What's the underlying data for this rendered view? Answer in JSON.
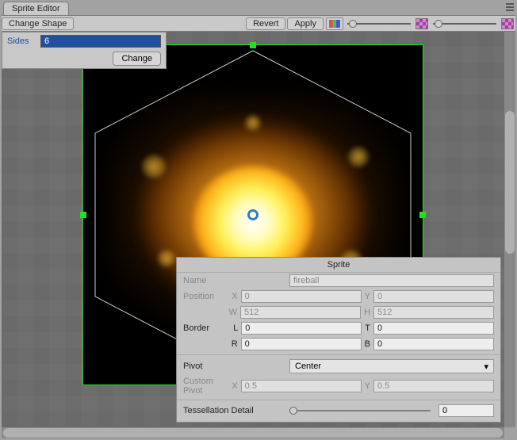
{
  "tab_title": "Sprite Editor",
  "toolbar": {
    "change_shape_label": "Change Shape",
    "revert_label": "Revert",
    "apply_label": "Apply"
  },
  "sides_panel": {
    "label": "Sides",
    "value": "6",
    "change_label": "Change"
  },
  "inspector": {
    "title": "Sprite",
    "name_label": "Name",
    "name_value": "fireball",
    "position_label": "Position",
    "x_label": "X",
    "x_value": "0",
    "y_label": "Y",
    "y_value": "0",
    "w_label": "W",
    "w_value": "512",
    "h_label": "H",
    "h_value": "512",
    "border_label": "Border",
    "l_label": "L",
    "l_value": "0",
    "t_label": "T",
    "t_value": "0",
    "r_label": "R",
    "r_value": "0",
    "b_label": "B",
    "b_value": "0",
    "pivot_label": "Pivot",
    "pivot_value": "Center",
    "custom_pivot_label": "Custom Pivot",
    "cp_x_label": "X",
    "cp_x_value": "0.5",
    "cp_y_label": "Y",
    "cp_y_value": "0.5",
    "tess_label": "Tessellation Detail",
    "tess_value": "0"
  }
}
